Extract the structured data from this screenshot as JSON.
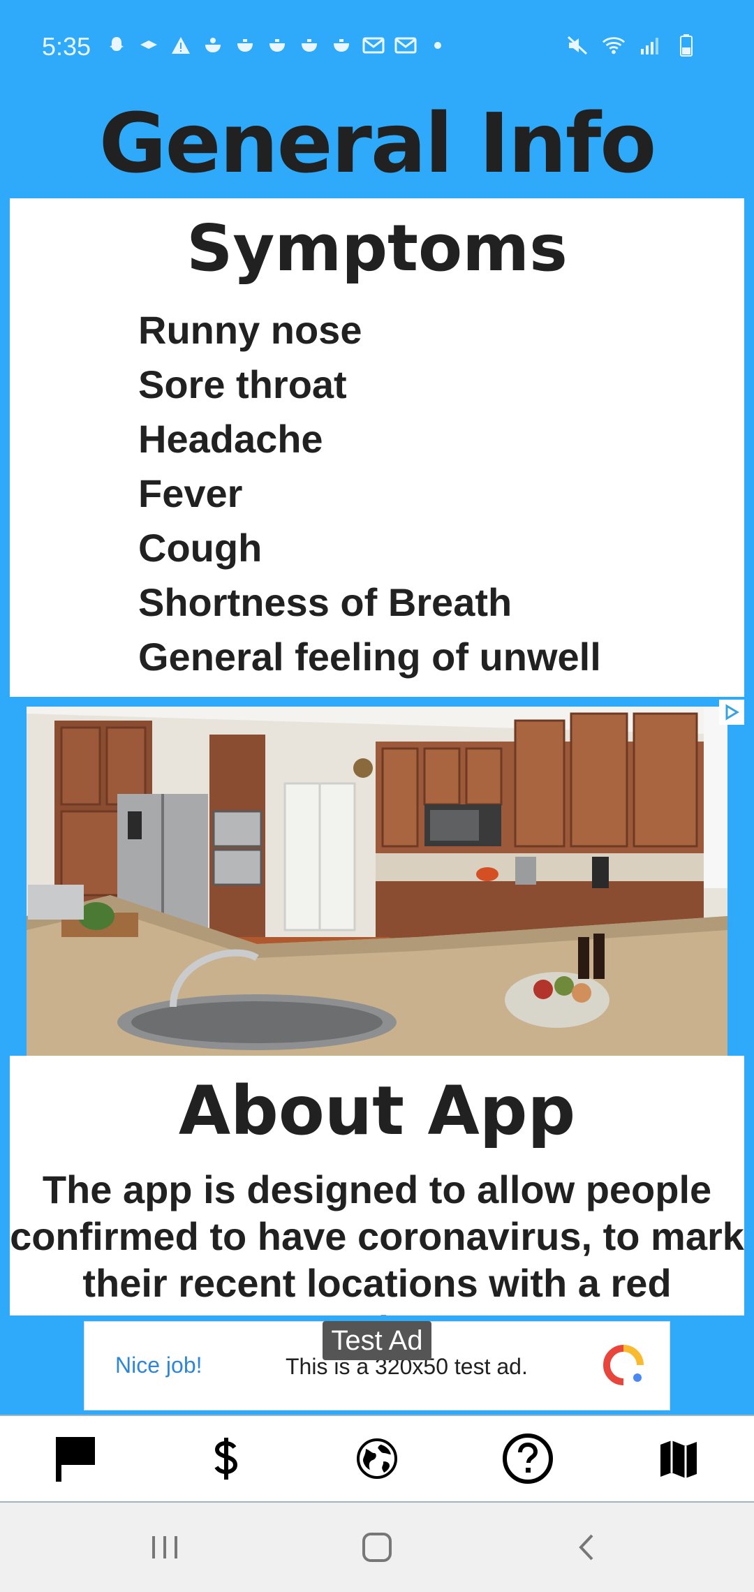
{
  "status_bar": {
    "time": "5:35",
    "left_icons": [
      "snapchat-icon",
      "airdrop-icon",
      "warning-icon",
      "bowl-icon",
      "bowl-icon",
      "bowl-icon",
      "bowl-icon",
      "bowl-icon",
      "mail-icon",
      "mail-icon",
      "dot-icon"
    ],
    "right_icons": [
      "mute-icon",
      "wifi-icon",
      "signal-icon",
      "battery-icon"
    ]
  },
  "title": "General Info",
  "symptoms": {
    "heading": "Symptoms",
    "items": [
      "Runny nose",
      "Sore throat",
      "Headache",
      "Fever",
      "Cough",
      "Shortness of Breath",
      "General feeling of unwell"
    ]
  },
  "about": {
    "heading": "About App",
    "text": "The app is designed to allow people confirmed to have coronavirus, to mark their recent locations with a red Marker."
  },
  "banner_ad": {
    "tag": "Test Ad",
    "good_label": "Nice job!",
    "text": "This is a 320x50 test ad."
  },
  "bottom_nav": {
    "items": [
      "flag-icon",
      "dollar-icon",
      "globe-icon",
      "help-icon",
      "map-icon"
    ]
  },
  "colors": {
    "background": "#2fa9f9",
    "card": "#ffffff",
    "text": "#212121"
  }
}
